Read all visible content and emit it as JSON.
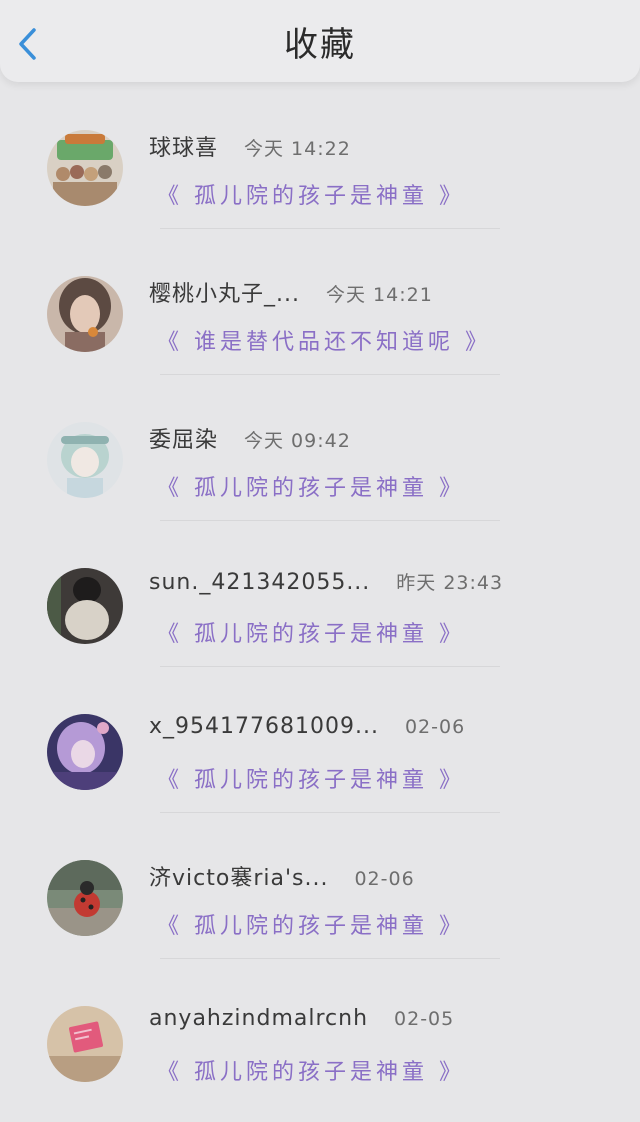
{
  "header": {
    "title": "收藏",
    "back_icon": "chevron-left-icon",
    "accent_color": "#3a8fd9"
  },
  "favorites": [
    {
      "username": "球球喜",
      "time": "今天 14:22",
      "subtitle": "《 孤儿院的孩子是神童 》",
      "avatar_icon": "group-illustration-avatar"
    },
    {
      "username": "樱桃小丸子_...",
      "time": "今天 14:21",
      "subtitle": "《 谁是替代品还不知道呢 》",
      "avatar_icon": "girl-portrait-avatar"
    },
    {
      "username": "委屈染",
      "time": "今天 09:42",
      "subtitle": "《 孤儿院的孩子是神童 》",
      "avatar_icon": "anime-girl-avatar"
    },
    {
      "username": "sun._421342055...",
      "time": "昨天 23:43",
      "subtitle": "《 孤儿院的孩子是神童 》",
      "avatar_icon": "dark-photo-avatar"
    },
    {
      "username": "x_954177681009...",
      "time": "02-06",
      "subtitle": "《 孤儿院的孩子是神童 》",
      "avatar_icon": "anime-character-avatar"
    },
    {
      "username": "济victo褰ria's...",
      "time": "02-06",
      "subtitle": "《 孤儿院的孩子是神童 》",
      "avatar_icon": "ladybug-toy-avatar"
    },
    {
      "username": "anyahzindmalrcnh",
      "time": "02-05",
      "subtitle": "《 孤儿院的孩子是神童 》",
      "avatar_icon": "pink-note-avatar"
    }
  ]
}
